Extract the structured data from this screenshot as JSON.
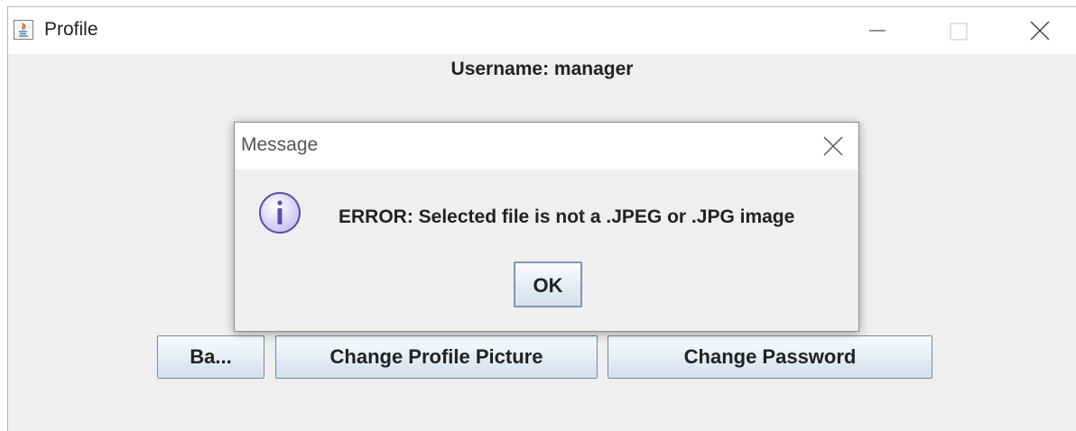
{
  "window": {
    "title": "Profile",
    "icon": "java-app-icon"
  },
  "window_controls": {
    "minimize": "minimize-icon",
    "maximize": "maximize-icon",
    "close": "close-icon"
  },
  "profile": {
    "username_label": "Username: manager"
  },
  "buttons": {
    "back_label": "Ba...",
    "change_picture_label": "Change Profile Picture",
    "change_password_label": "Change Password"
  },
  "dialog": {
    "title": "Message",
    "icon": "info-icon",
    "message": "ERROR: Selected file is not a .JPEG or .JPG image",
    "ok_label": "OK"
  },
  "colors": {
    "button_border": "#7a8a9e",
    "dialog_bg": "#efefef",
    "titlebar_bg": "#ffffff",
    "info_icon_fill": "#d9d4f4"
  }
}
